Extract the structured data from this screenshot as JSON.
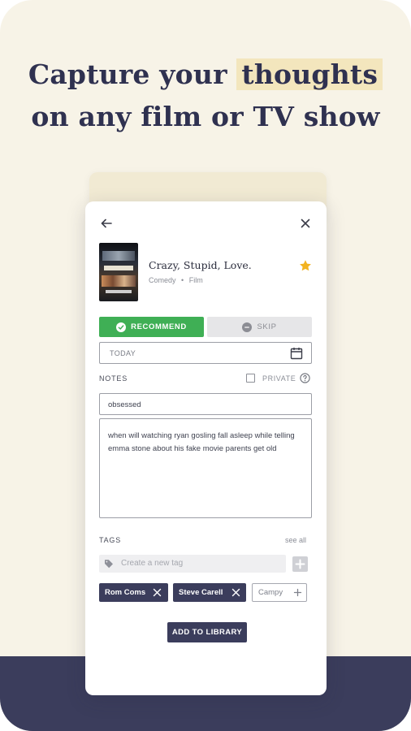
{
  "headline": {
    "line1_prefix": "Capture your",
    "line1_highlight": "thoughts",
    "line2": "on any film or TV show"
  },
  "movie": {
    "title": "Crazy, Stupid, Love.",
    "genre": "Comedy",
    "separator": "•",
    "type": "Film"
  },
  "actions": {
    "recommend_label": "RECOMMEND",
    "skip_label": "SKIP"
  },
  "date_field": {
    "value": "TODAY"
  },
  "notes": {
    "label": "NOTES",
    "private_label": "PRIVATE",
    "short_note": "obsessed",
    "long_note": "when will watching ryan gosling fall asleep while telling emma stone about his fake movie parents get old"
  },
  "tags": {
    "label": "TAGS",
    "see_all": "see all",
    "placeholder": "Create a new tag",
    "chips": [
      {
        "label": "Rom Coms",
        "selected": true
      },
      {
        "label": "Steve Carell",
        "selected": true
      },
      {
        "label": "Campy",
        "selected": false
      }
    ]
  },
  "add_to_library_label": "ADD TO LIBRARY",
  "colors": {
    "background": "#f7f3e7",
    "navy": "#3b3d5c",
    "green": "#3faf55",
    "highlight": "#f3e6bd",
    "star": "#f2b321"
  }
}
